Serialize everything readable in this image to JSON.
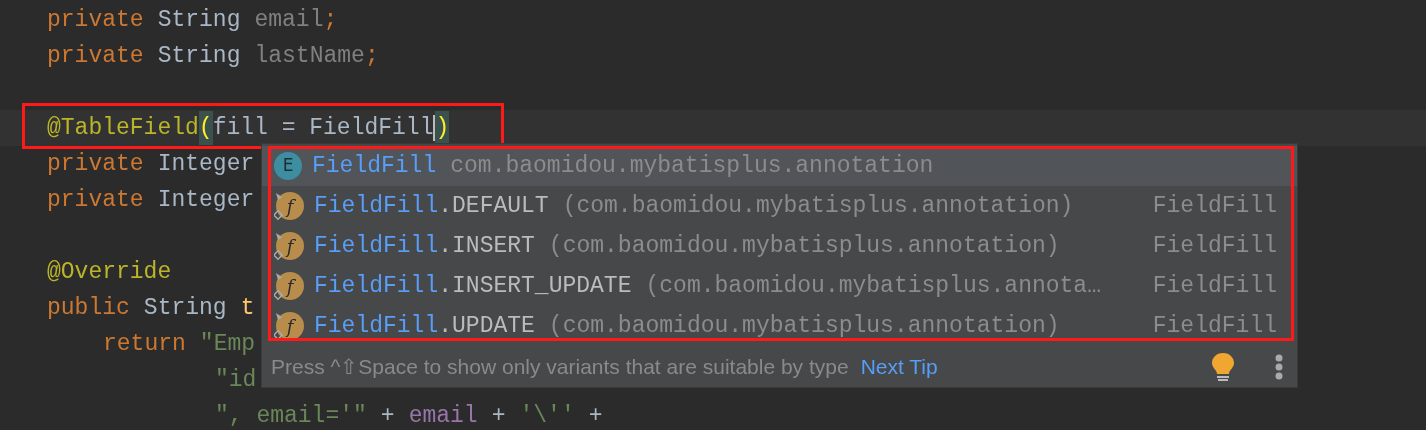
{
  "code_lines": [
    {
      "kind": "member",
      "tokens": [
        {
          "kind": "keyword",
          "text": "private"
        },
        {
          "kind": "plain",
          "text": "String"
        },
        {
          "kind": "unused",
          "text": "email"
        },
        {
          "kind": "semi",
          "text": ";"
        }
      ]
    },
    {
      "kind": "member",
      "tokens": [
        {
          "kind": "keyword",
          "text": "private"
        },
        {
          "kind": "plain",
          "text": "String"
        },
        {
          "kind": "unused",
          "text": "lastName"
        },
        {
          "kind": "semi",
          "text": ";"
        }
      ]
    },
    {
      "kind": "blank"
    },
    {
      "kind": "member",
      "current": true,
      "tokens": [
        {
          "kind": "annotation",
          "text": "@TableField"
        },
        {
          "kind": "brace",
          "text": "("
        },
        {
          "kind": "plain",
          "text": "fill = FieldFill"
        },
        {
          "kind": "caret"
        },
        {
          "kind": "brace",
          "text": ")"
        }
      ]
    },
    {
      "kind": "member",
      "tokens": [
        {
          "kind": "keyword",
          "text": "private"
        },
        {
          "kind": "plain",
          "text": "Integer"
        }
      ]
    },
    {
      "kind": "member",
      "tokens": [
        {
          "kind": "keyword",
          "text": "private"
        },
        {
          "kind": "plain",
          "text": "Integer"
        }
      ]
    },
    {
      "kind": "blank"
    },
    {
      "kind": "member",
      "tokens": [
        {
          "kind": "annotation",
          "text": "@Override"
        }
      ]
    },
    {
      "kind": "member",
      "tokens": [
        {
          "kind": "keyword",
          "text": "public"
        },
        {
          "kind": "plain",
          "text": "String"
        },
        {
          "kind": "method",
          "text": "t"
        }
      ]
    },
    {
      "kind": "statement",
      "tokens": [
        {
          "kind": "keyword",
          "text": "return"
        },
        {
          "kind": "string",
          "text": "\"Emp"
        }
      ]
    },
    {
      "kind": "continuation",
      "tokens": [
        {
          "kind": "string",
          "text": "\"id"
        }
      ]
    },
    {
      "kind": "continuation",
      "tokens": [
        {
          "kind": "string",
          "text": "\", email='\""
        },
        {
          "kind": "plain",
          "text": "+"
        },
        {
          "kind": "field",
          "text": "email"
        },
        {
          "kind": "plain",
          "text": "+"
        },
        {
          "kind": "string",
          "text": "'\\''"
        },
        {
          "kind": "plain",
          "text": "+"
        }
      ]
    }
  ],
  "completion": {
    "items": [
      {
        "kind": "enum",
        "icon_letter": "E",
        "name": "FieldFill",
        "location": "com.baomidou.mybatisplus.annotation",
        "selected": true
      },
      {
        "kind": "field",
        "icon_letter": "f",
        "name": "FieldFill",
        "member": ".DEFAULT",
        "location": "(com.baomidou.mybatisplus.annotation)",
        "type": "FieldFill",
        "selected": false
      },
      {
        "kind": "field",
        "icon_letter": "f",
        "name": "FieldFill",
        "member": ".INSERT",
        "location": "(com.baomidou.mybatisplus.annotation)",
        "type": "FieldFill",
        "selected": false
      },
      {
        "kind": "field",
        "icon_letter": "f",
        "name": "FieldFill",
        "member": ".INSERT_UPDATE",
        "location": "(com.baomidou.mybatisplus.annota…",
        "type": "FieldFill",
        "selected": false
      },
      {
        "kind": "field",
        "icon_letter": "f",
        "name": "FieldFill",
        "member": ".UPDATE",
        "location": "(com.baomidou.mybatisplus.annotation)",
        "type": "FieldFill",
        "selected": false
      }
    ],
    "hint": "Press ^⇧Space to show only variants that are suitable by type",
    "next_tip": "Next Tip"
  }
}
